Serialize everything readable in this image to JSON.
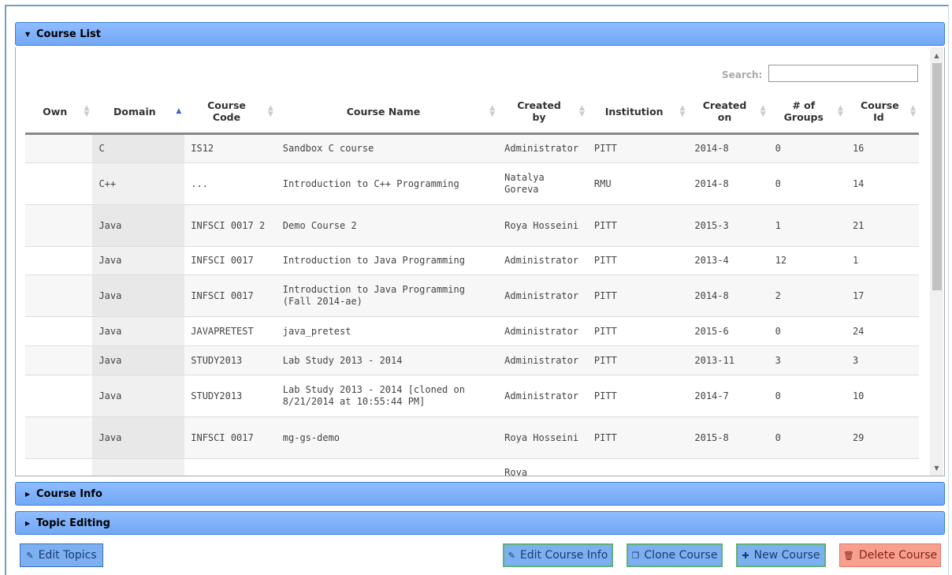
{
  "panels": {
    "course_list": "Course List",
    "course_info": "Course Info",
    "topic_editing": "Topic Editing"
  },
  "search": {
    "label": "Search:",
    "value": ""
  },
  "columns": [
    "Own",
    "Domain",
    "Course Code",
    "Course Name",
    "Created by",
    "Institution",
    "Created on",
    "# of Groups",
    "Course Id"
  ],
  "rows": [
    {
      "own": "",
      "domain": "C",
      "code": "IS12",
      "name": "Sandbox C course",
      "created_by": "Administrator",
      "institution": "PITT",
      "created_on": "2014-8",
      "groups": "0",
      "id": "16"
    },
    {
      "own": "",
      "domain": "C++",
      "code": "...",
      "name": "Introduction to C++ Programming",
      "created_by": "Natalya Goreva",
      "institution": "RMU",
      "created_on": "2014-8",
      "groups": "0",
      "id": "14"
    },
    {
      "own": "",
      "domain": "Java",
      "code": "INFSCI 0017 2",
      "name": "Demo Course 2",
      "created_by": "Roya Hosseini",
      "institution": "PITT",
      "created_on": "2015-3",
      "groups": "1",
      "id": "21"
    },
    {
      "own": "",
      "domain": "Java",
      "code": "INFSCI 0017",
      "name": "Introduction to Java Programming",
      "created_by": "Administrator",
      "institution": "PITT",
      "created_on": "2013-4",
      "groups": "12",
      "id": "1"
    },
    {
      "own": "",
      "domain": "Java",
      "code": "INFSCI 0017",
      "name": "Introduction to Java Programming (Fall 2014-ae)",
      "created_by": "Administrator",
      "institution": "PITT",
      "created_on": "2014-8",
      "groups": "2",
      "id": "17"
    },
    {
      "own": "",
      "domain": "Java",
      "code": "JAVAPRETEST",
      "name": "java_pretest",
      "created_by": "Administrator",
      "institution": "PITT",
      "created_on": "2015-6",
      "groups": "0",
      "id": "24"
    },
    {
      "own": "",
      "domain": "Java",
      "code": "STUDY2013",
      "name": "Lab Study 2013 - 2014",
      "created_by": "Administrator",
      "institution": "PITT",
      "created_on": "2013-11",
      "groups": "3",
      "id": "3"
    },
    {
      "own": "",
      "domain": "Java",
      "code": "STUDY2013",
      "name": "Lab Study 2013 - 2014 [cloned on 8/21/2014 at 10:55:44 PM]",
      "created_by": "Administrator",
      "institution": "PITT",
      "created_on": "2014-7",
      "groups": "0",
      "id": "10"
    },
    {
      "own": "",
      "domain": "Java",
      "code": "INFSCI 0017",
      "name": "mg-gs-demo",
      "created_by": "Roya Hosseini",
      "institution": "PITT",
      "created_on": "2015-8",
      "groups": "0",
      "id": "29"
    },
    {
      "own": "",
      "domain": "",
      "code": "",
      "name": "",
      "created_by": "Roya",
      "institution": "",
      "created_on": "",
      "groups": "",
      "id": ""
    }
  ],
  "buttons": {
    "edit_topics": "Edit Topics",
    "edit_course_info": "Edit Course Info",
    "clone_course": "Clone Course",
    "new_course": "New Course",
    "delete_course": "Delete Course"
  },
  "icons": {
    "edit_topics": "pencil-icon",
    "edit_course_info": "pencil-icon",
    "clone_course": "copy-icon",
    "new_course": "plus-icon",
    "delete_course": "trash-icon"
  },
  "colors": {
    "header_blue": "#7ab0f8",
    "delete_red": "#f7a090"
  },
  "sort": {
    "column": "Domain",
    "direction": "ascending"
  }
}
